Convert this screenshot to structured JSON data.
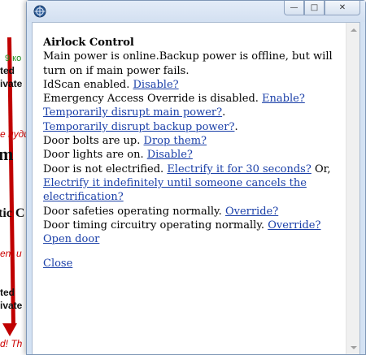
{
  "background": {
    "fragments": {
      "green": "9  ко",
      "line1": "ted",
      "line2": "ivate",
      "red1": "е пуди",
      "big": "m",
      "mid": "tic C",
      "red2": "ent u",
      "line3": "ted",
      "line4": "ivate",
      "red3": "d! Th"
    },
    "colors": {
      "arrow": "#c00000",
      "green_text": "#1a8a1a",
      "red_text": "#cc0000"
    }
  },
  "window": {
    "controls": {
      "minimize": "—",
      "maximize": "□",
      "close": "✕"
    },
    "icon": "app-globe-icon"
  },
  "dialog": {
    "title": "Airlock Control",
    "power_status": "Main power is online.Backup power is offline, but will turn on if main power fails.",
    "idscan_text": "IdScan enabled. ",
    "idscan_link": "Disable?",
    "override_text": "Emergency Access Override is disabled. ",
    "override_link": "Enable?",
    "disrupt_main_link": "Temporarily disrupt main power?",
    "disrupt_main_suffix": ".",
    "disrupt_backup_link": "Temporarily disrupt backup power?",
    "disrupt_backup_suffix": ".",
    "bolts_text": "Door bolts are up. ",
    "bolts_link": "Drop them?",
    "lights_text": "Door lights are on. ",
    "lights_link": "Disable?",
    "electrified_text": "Door is not electrified. ",
    "electrify30_link": "Electrify it for 30 seconds?",
    "electrify_or": " Or,",
    "electrify_indef_link": "Electrify it indefinitely until someone cancels the electrification?",
    "safeties_text": "Door safeties operating normally. ",
    "safeties_link": "Override?",
    "timing_text": "Door timing circuitry operating normally. ",
    "timing_link": "Override?",
    "open_door_link": "Open door",
    "close_link": "Close"
  },
  "colors": {
    "link": "#1a3fa8",
    "window_frame": "#d4e2f3"
  }
}
